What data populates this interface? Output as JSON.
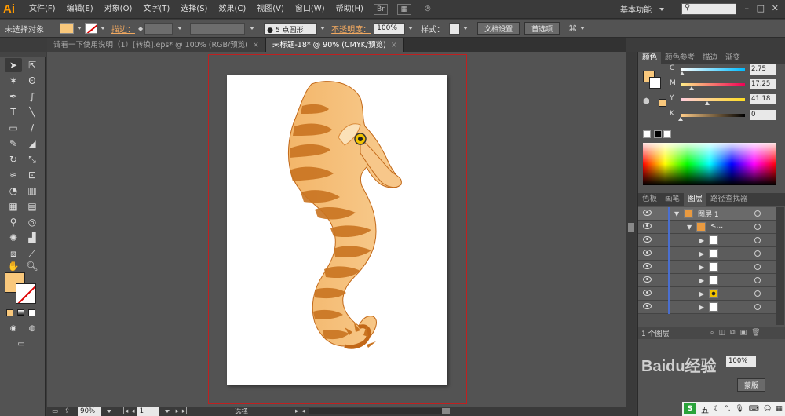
{
  "menubar": {
    "logo": "Ai",
    "items": [
      "文件(F)",
      "编辑(E)",
      "对象(O)",
      "文字(T)",
      "选择(S)",
      "效果(C)",
      "视图(V)",
      "窗口(W)",
      "帮助(H)"
    ],
    "icon1": "Br",
    "workspace": "基本功能",
    "minimize": "–",
    "maximize": "□",
    "close": "✕"
  },
  "controlbar": {
    "no_selection": "未选择对象",
    "stroke_label": "描边：",
    "brush": "5 点圆形",
    "opacity_label": "不透明度：",
    "opacity_value": "100%",
    "style_label": "样式：",
    "doc_setup": "文档设置",
    "preferences": "首选项"
  },
  "tabs": [
    {
      "label": "请看一下使用说明（1）[转换].eps* @ 100% (RGB/预览)"
    },
    {
      "label": "未标题-18* @ 90% (CMYK/预览)"
    }
  ],
  "colors": {
    "fill": "#f9c87c",
    "seahorse_light": "#f8c88a",
    "seahorse_mid": "#e9973a",
    "seahorse_dark": "#c26818"
  },
  "color_panel": {
    "tabs": [
      "颜色",
      "颜色参考",
      "描边",
      "渐变"
    ],
    "sliders": [
      {
        "label": "C",
        "value": "2.75",
        "fraction": 0.03
      },
      {
        "label": "M",
        "value": "17.25",
        "fraction": 0.17
      },
      {
        "label": "Y",
        "value": "41.18",
        "fraction": 0.41
      },
      {
        "label": "K",
        "value": "0",
        "fraction": 0.0
      }
    ]
  },
  "layers_panel": {
    "tabs": [
      "色板",
      "画笔",
      "图层",
      "路径查找器"
    ],
    "layer_name": "图层 1",
    "group_name": "<...",
    "footer": "1 个图层"
  },
  "statusbar": {
    "zoom": "90%",
    "page": "1",
    "tool": "选择"
  },
  "lower_panel": {
    "opacity": "100%",
    "watermark": "Baidu经验",
    "button": "蒙版"
  },
  "taskbar": {
    "ime": "五"
  }
}
